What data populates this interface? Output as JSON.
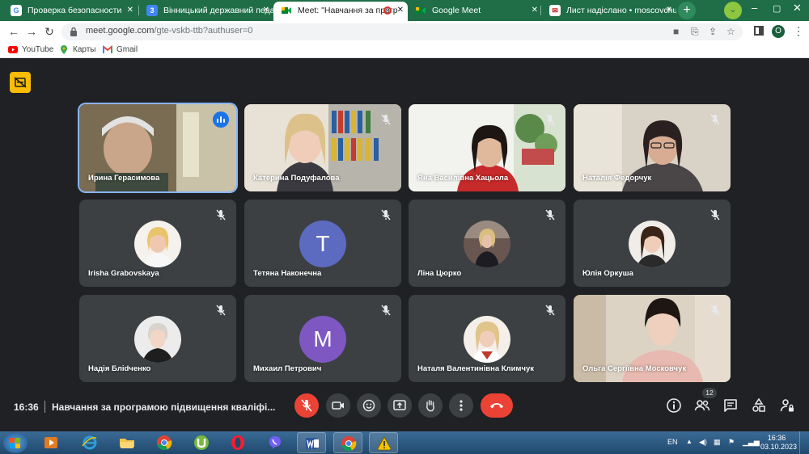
{
  "browser": {
    "tabs": [
      {
        "title": "Проверка безопасности",
        "favicon": "google-g-icon",
        "active": false
      },
      {
        "title": "Вінницький державний педаг",
        "favicon": "calendar-icon",
        "active": false
      },
      {
        "title": "Meet: \"Навчання за прогр",
        "favicon": "meet-icon",
        "active": true
      },
      {
        "title": "Google Meet",
        "favicon": "meet-icon",
        "active": false
      },
      {
        "title": "Лист надіслано • moscovchuk",
        "favicon": "mail-icon",
        "active": false
      }
    ],
    "url": "meet.google.com",
    "url_path": "/gte-vskb-ttb?authuser=0",
    "profile_initial": "O",
    "bookmarks": [
      {
        "label": "YouTube",
        "icon": "youtube-icon"
      },
      {
        "label": "Карты",
        "icon": "maps-icon"
      },
      {
        "label": "Gmail",
        "icon": "gmail-icon"
      }
    ]
  },
  "meet": {
    "time": "16:36",
    "title": "Навчання за програмою підвищення кваліфі...",
    "participant_count": "12",
    "participants": [
      {
        "name": "Ирина Герасимова",
        "kind": "video",
        "speaking": true
      },
      {
        "name": "Катерина Подуфалова",
        "kind": "video",
        "muted": true
      },
      {
        "name": "Яна Василівна Хацьола",
        "kind": "video",
        "muted": true
      },
      {
        "name": "Наталія Федорчук",
        "kind": "video",
        "muted": true
      },
      {
        "name": "Irisha Grabovskaya",
        "kind": "photo",
        "muted": true
      },
      {
        "name": "Тетяна Наконечна",
        "kind": "letter",
        "letter": "T",
        "color": "#5c6bc0",
        "muted": true
      },
      {
        "name": "Ліна Цюрко",
        "kind": "photo",
        "muted": true
      },
      {
        "name": "Юлія Оркуша",
        "kind": "photo",
        "muted": true
      },
      {
        "name": "Надія Бліdченко",
        "kind": "photo",
        "muted": true
      },
      {
        "name": "Михаил Петрович",
        "kind": "letter",
        "letter": "M",
        "color": "#7e57c2",
        "muted": true
      },
      {
        "name": "Наталя Валентинівна Климчук",
        "kind": "photo",
        "muted": true
      },
      {
        "name": "Ольга Сергіївна Московчук",
        "kind": "video",
        "muted": true
      }
    ],
    "colors": {
      "background": "#202124",
      "tile": "#3c4043",
      "danger": "#ea4335",
      "speaking": "#8ab4f8"
    }
  },
  "taskbar": {
    "language": "EN",
    "time": "16:36",
    "date": "03.10.2023"
  }
}
